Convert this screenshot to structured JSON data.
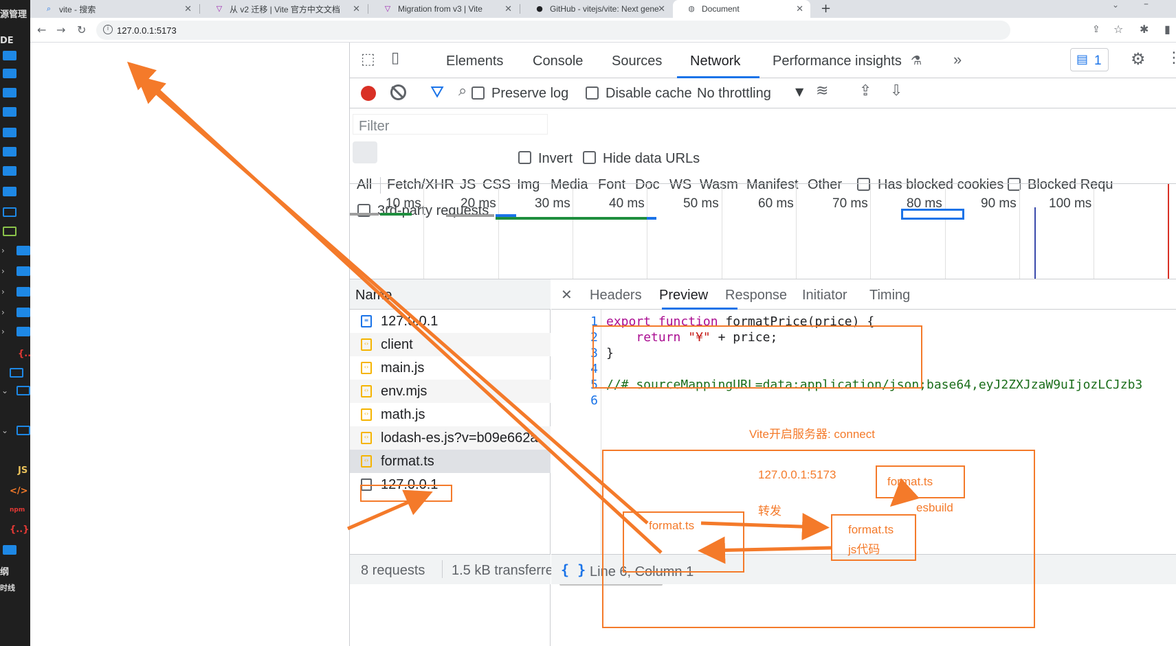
{
  "colors": {
    "accent": "#1a73e8",
    "annotation": "#f47a2a",
    "record": "#d93025",
    "vscode_bg": "#1f1f1f"
  },
  "vscode": {
    "title_fragment": "源管理",
    "section_label": "DE",
    "footer_1": "纲",
    "footer_2": "时线",
    "js_label": "JS",
    "npm_label": "npm"
  },
  "browser": {
    "tabs": [
      {
        "title": "vite - 搜索",
        "icon": "search-icon"
      },
      {
        "title": "从 v2 迁移 | Vite 官方中文文档",
        "icon": "vite-logo-icon"
      },
      {
        "title": "Migration from v3 | Vite",
        "icon": "vite-logo-icon"
      },
      {
        "title": "GitHub - vitejs/vite: Next gene",
        "icon": "github-icon"
      },
      {
        "title": "Document",
        "icon": "globe-icon"
      }
    ],
    "new_tab": "+",
    "url": "127.0.0.1:5173"
  },
  "devtools": {
    "panels": [
      "Elements",
      "Console",
      "Sources",
      "Network",
      "Performance insights"
    ],
    "active_panel": "Network",
    "more": "»",
    "issues_count": "1",
    "toolbar": {
      "preserve_log": "Preserve log",
      "disable_cache": "Disable cache",
      "throttling": "No throttling"
    },
    "filter": {
      "placeholder": "Filter",
      "invert": "Invert",
      "hide_data_urls": "Hide data URLs"
    },
    "type_filters": [
      "All",
      "Fetch/XHR",
      "JS",
      "CSS",
      "Img",
      "Media",
      "Font",
      "Doc",
      "WS",
      "Wasm",
      "Manifest",
      "Other"
    ],
    "has_blocked_cookies": "Has blocked cookies",
    "blocked_requests": "Blocked Requ",
    "third_party": "3rd-party requests",
    "timeline_labels": [
      "10 ms",
      "20 ms",
      "30 ms",
      "40 ms",
      "50 ms",
      "60 ms",
      "70 ms",
      "80 ms",
      "90 ms",
      "100 ms"
    ],
    "name_header": "Name",
    "requests": [
      {
        "name": "127.0.0.1",
        "type": "doc"
      },
      {
        "name": "client",
        "type": "js"
      },
      {
        "name": "main.js",
        "type": "js"
      },
      {
        "name": "env.mjs",
        "type": "js"
      },
      {
        "name": "math.js",
        "type": "js"
      },
      {
        "name": "lodash-es.js?v=b09e662a",
        "type": "js"
      },
      {
        "name": "format.ts",
        "type": "js"
      },
      {
        "name": "127.0.0.1",
        "type": "plain"
      }
    ],
    "summary": {
      "requests": "8 requests",
      "transferred": "1.5 kB transferre"
    },
    "detail_tabs": [
      "Headers",
      "Preview",
      "Response",
      "Initiator",
      "Timing"
    ],
    "active_detail": "Preview",
    "code_lines": [
      {
        "n": "1",
        "text": "export function formatPrice(price) {"
      },
      {
        "n": "2",
        "text": "    return \"¥\" + price;"
      },
      {
        "n": "3",
        "text": "}"
      },
      {
        "n": "4",
        "text": ""
      },
      {
        "n": "5",
        "text": "//# sourceMappingURL=data:application/json;base64,eyJ2ZXJzaW9uIjozLCJzb3"
      },
      {
        "n": "6",
        "text": ""
      }
    ],
    "pretty_print": "{ }",
    "cursor_position": "Line 6, Column 1"
  },
  "annotations": {
    "server_note": "Vite开启服务器: connect",
    "host": "127.0.0.1:5173",
    "forward": "转发",
    "format_ts_left": "format.ts",
    "format_ts_top": "format.ts",
    "esbuild": "esbuild",
    "format_ts_js_1": "format.ts",
    "format_ts_js_2": "js代码"
  }
}
